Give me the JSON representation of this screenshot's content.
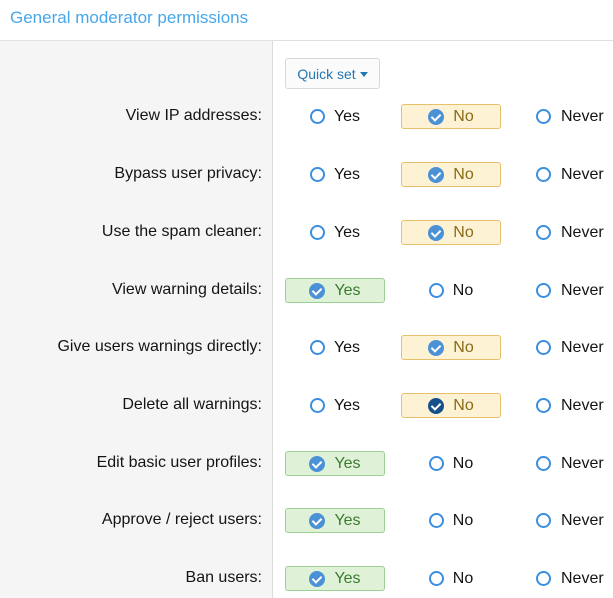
{
  "header": {
    "title": "General moderator permissions"
  },
  "quick_set": {
    "label": "Quick set"
  },
  "options": {
    "yes": "Yes",
    "no": "No",
    "never": "Never"
  },
  "colors": {
    "accent": "#47a7eb",
    "selected_yes_bg": "#dff2d8",
    "selected_no_bg": "#fdf3d4"
  },
  "rows": [
    {
      "label": "View IP addresses:",
      "selected": "no"
    },
    {
      "label": "Bypass user privacy:",
      "selected": "no"
    },
    {
      "label": "Use the spam cleaner:",
      "selected": "no"
    },
    {
      "label": "View warning details:",
      "selected": "yes"
    },
    {
      "label": "Give users warnings directly:",
      "selected": "no"
    },
    {
      "label": "Delete all warnings:",
      "selected": "no"
    },
    {
      "label": "Edit basic user profiles:",
      "selected": "yes"
    },
    {
      "label": "Approve / reject users:",
      "selected": "yes"
    },
    {
      "label": "Ban users:",
      "selected": "yes"
    }
  ]
}
